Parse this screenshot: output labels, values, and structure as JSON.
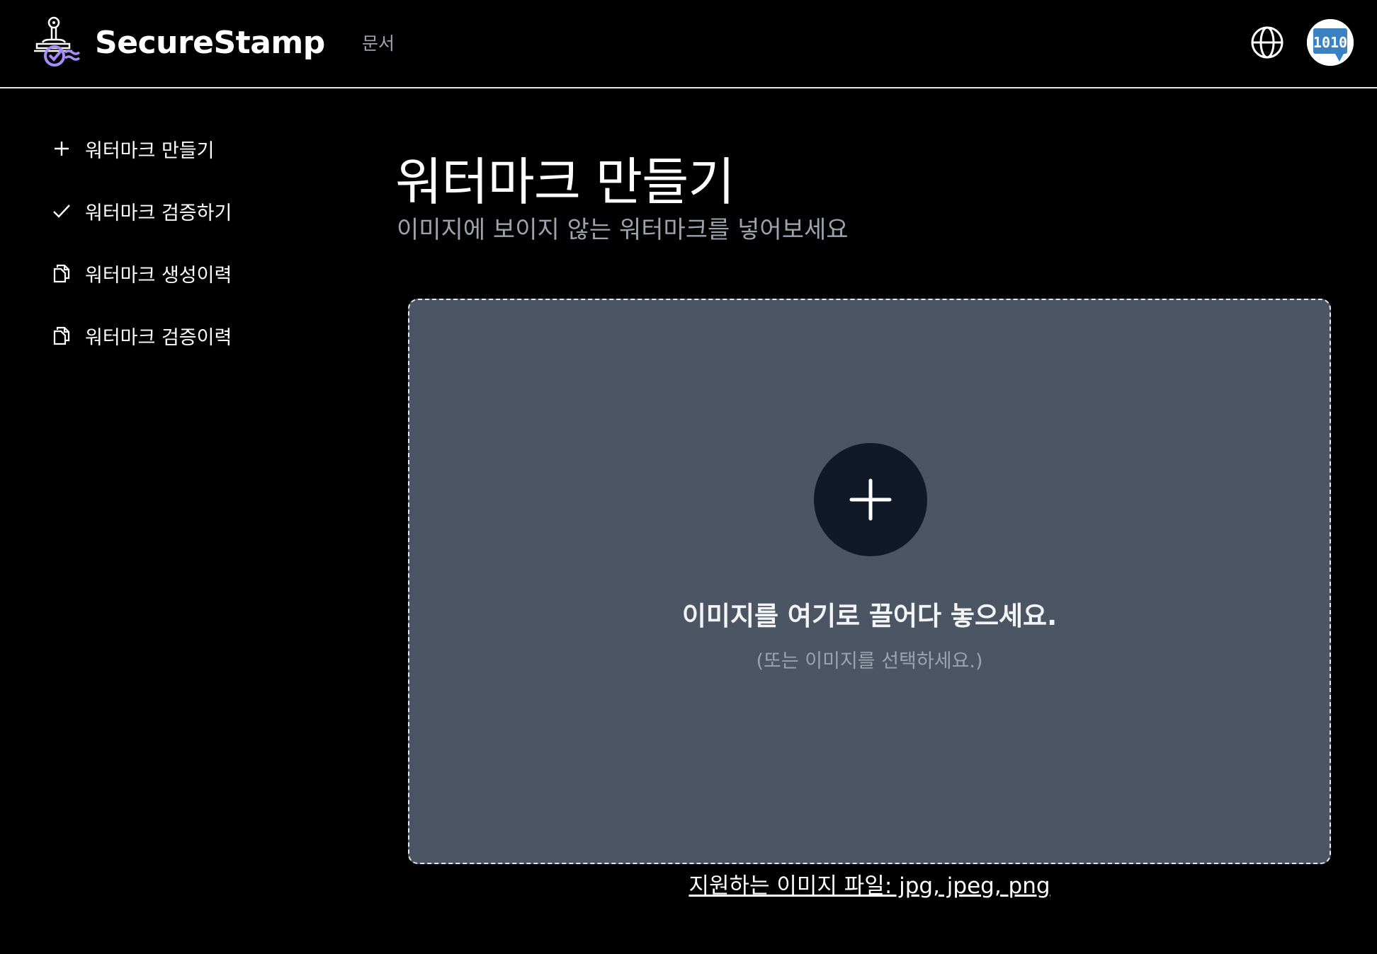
{
  "header": {
    "brand_name": "SecureStamp",
    "nav_docs": "문서",
    "avatar_text": "1010"
  },
  "sidebar": {
    "items": [
      {
        "label": "워터마크 만들기",
        "icon": "plus-icon"
      },
      {
        "label": "워터마크 검증하기",
        "icon": "check-icon"
      },
      {
        "label": "워터마크 생성이력",
        "icon": "copy-icon"
      },
      {
        "label": "워터마크 검증이력",
        "icon": "copy-icon"
      }
    ]
  },
  "main": {
    "title": "워터마크 만들기",
    "subtitle": "이미지에 보이지 않는 워터마크를 넣어보세요",
    "dropzone": {
      "icon": "plus-icon",
      "title": "이미지를 여기로 끌어다 놓으세요.",
      "subtitle": "(또는 이미지를 선택하세요.)"
    },
    "supported_formats": "지원하는 이미지 파일: jpg, jpeg, png"
  },
  "colors": {
    "background": "#000000",
    "dropzone_bg": "#4b5563",
    "circle_bg": "#111827",
    "muted_text": "#9ca3af",
    "brand_accent": "#a78bfa"
  }
}
